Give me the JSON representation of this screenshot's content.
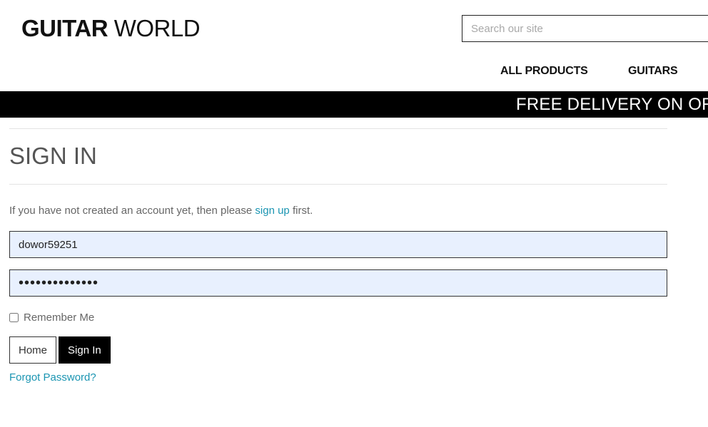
{
  "header": {
    "logo_bold": "GUITAR",
    "logo_light": " WORLD",
    "search_placeholder": "Search our site",
    "nav": {
      "all_products": "ALL PRODUCTS",
      "guitars": "GUITARS"
    }
  },
  "banner": {
    "text": "FREE DELIVERY ON ORD"
  },
  "signin": {
    "title": "SIGN IN",
    "intro_before": "If you have not created an account yet, then please ",
    "intro_link": "sign up",
    "intro_after": " first.",
    "username_value": "dowor59251",
    "password_value": "••••••••••••••",
    "remember_label": "Remember Me",
    "home_button": "Home",
    "signin_button": "Sign In",
    "forgot_link": "Forgot Password?"
  },
  "colors": {
    "link": "#1b95b2",
    "banner_bg": "#000000",
    "autofill_bg": "#e8f0fe"
  }
}
